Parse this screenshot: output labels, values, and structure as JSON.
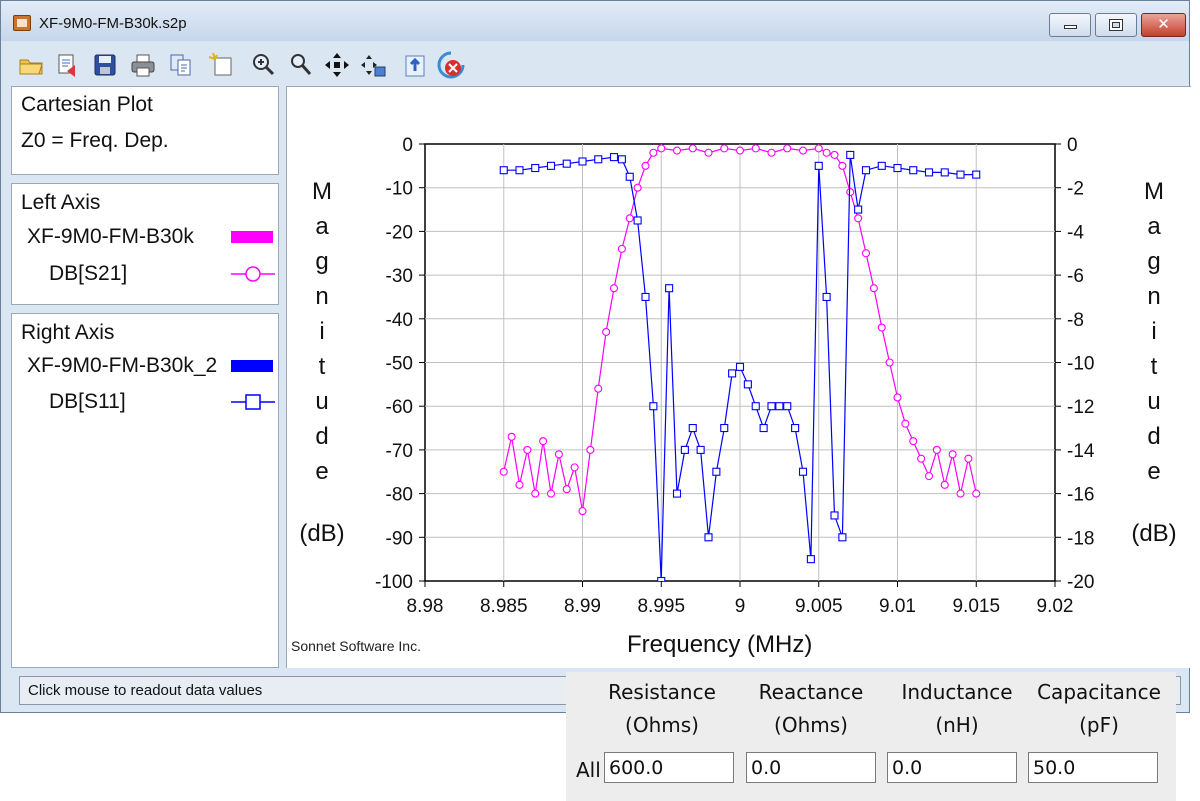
{
  "window": {
    "title": "XF-9M0-FM-B30k.s2p"
  },
  "toolbar": {
    "icons": [
      "open-folder-icon",
      "export-icon",
      "save-icon",
      "print-icon",
      "copy-icon",
      "new-plot-icon",
      "zoom-in-icon",
      "zoom-out-icon",
      "pan-icon",
      "measure-icon",
      "refresh-icon",
      "stop-icon"
    ]
  },
  "info_panel": {
    "title": "Cartesian Plot",
    "z0": "Z0 = Freq. Dep."
  },
  "left_axis_panel": {
    "heading": "Left Axis",
    "file": "XF-9M0-FM-B30k",
    "trace": "DB[S21]",
    "color": "#ff00ff"
  },
  "right_axis_panel": {
    "heading": "Right Axis",
    "file": "XF-9M0-FM-B30k_2",
    "trace": "DB[S11]",
    "color": "#0000ff"
  },
  "chart_data": {
    "type": "line",
    "xlabel": "Frequency (MHz)",
    "ylabel_left": "Magnitude",
    "ylabel_left_unit": "(dB)",
    "ylabel_right": "Magnitude",
    "ylabel_right_unit": "(dB)",
    "xlim": [
      8.98,
      9.02
    ],
    "ylim_left": [
      -100,
      0
    ],
    "ylim_right": [
      -20,
      0
    ],
    "x_ticks": [
      "8.98",
      "8.985",
      "8.99",
      "8.995",
      "9",
      "9.005",
      "9.01",
      "9.015",
      "9.02"
    ],
    "y_ticks_left": [
      "0",
      "-10",
      "-20",
      "-30",
      "-40",
      "-50",
      "-60",
      "-70",
      "-80",
      "-90",
      "-100"
    ],
    "y_ticks_right": [
      "0",
      "-2",
      "-4",
      "-6",
      "-8",
      "-10",
      "-12",
      "-14",
      "-16",
      "-18",
      "-20"
    ],
    "grid": true,
    "series": [
      {
        "name": "DB[S21]",
        "axis": "left",
        "color": "#ff00ff",
        "marker": "circle",
        "x": [
          8.985,
          8.9855,
          8.986,
          8.9865,
          8.987,
          8.9875,
          8.988,
          8.9885,
          8.989,
          8.9895,
          8.99,
          8.9905,
          8.991,
          8.9915,
          8.992,
          8.9925,
          8.993,
          8.9935,
          8.994,
          8.9945,
          8.995,
          8.996,
          8.997,
          8.998,
          8.999,
          9.0,
          9.001,
          9.002,
          9.003,
          9.004,
          9.005,
          9.0055,
          9.006,
          9.0065,
          9.007,
          9.0075,
          9.008,
          9.0085,
          9.009,
          9.0095,
          9.01,
          9.0105,
          9.011,
          9.0115,
          9.012,
          9.0125,
          9.013,
          9.0135,
          9.014,
          9.0145,
          9.015
        ],
        "y": [
          -75,
          -67,
          -78,
          -70,
          -80,
          -68,
          -80,
          -71,
          -79,
          -74,
          -84,
          -70,
          -56,
          -43,
          -33,
          -24,
          -17,
          -10,
          -5,
          -2,
          -1,
          -1.5,
          -1,
          -2,
          -1,
          -1.5,
          -1,
          -2,
          -1,
          -1.5,
          -1,
          -2,
          -2.5,
          -5,
          -11,
          -17,
          -25,
          -33,
          -42,
          -50,
          -58,
          -64,
          -68,
          -72,
          -76,
          -70,
          -78,
          -71,
          -80,
          -72,
          -80
        ]
      },
      {
        "name": "DB[S11]",
        "axis": "right",
        "color": "#0000ff",
        "marker": "square",
        "x": [
          8.985,
          8.986,
          8.987,
          8.988,
          8.989,
          8.99,
          8.991,
          8.992,
          8.9925,
          8.993,
          8.9935,
          8.994,
          8.9945,
          8.995,
          8.9955,
          8.996,
          8.9965,
          8.997,
          8.9975,
          8.998,
          8.9985,
          8.999,
          8.9995,
          9.0,
          9.0005,
          9.001,
          9.0015,
          9.002,
          9.0025,
          9.003,
          9.0035,
          9.004,
          9.0045,
          9.005,
          9.0055,
          9.006,
          9.0065,
          9.007,
          9.0075,
          9.008,
          9.009,
          9.01,
          9.011,
          9.012,
          9.013,
          9.014,
          9.015
        ],
        "y": [
          -1.2,
          -1.2,
          -1.1,
          -1.0,
          -0.9,
          -0.8,
          -0.7,
          -0.6,
          -0.7,
          -1.5,
          -3.5,
          -7,
          -12,
          -20,
          -6.6,
          -16,
          -14,
          -13,
          -14,
          -18,
          -15,
          -13,
          -10.5,
          -10.2,
          -11,
          -12,
          -13,
          -12,
          -12,
          -12,
          -13,
          -15,
          -19,
          -1,
          -7,
          -17,
          -18,
          -0.5,
          -3,
          -1.2,
          -1.0,
          -1.1,
          -1.2,
          -1.3,
          -1.3,
          -1.4,
          -1.4
        ]
      }
    ],
    "watermark": "Sonnet Software Inc."
  },
  "status": {
    "text": "Click mouse to readout data values"
  },
  "dialog": {
    "headers": [
      {
        "name": "Resistance",
        "unit": "(Ohms)"
      },
      {
        "name": "Reactance",
        "unit": "(Ohms)"
      },
      {
        "name": "Inductance",
        "unit": "(nH)"
      },
      {
        "name": "Capacitance",
        "unit": "(pF)"
      }
    ],
    "row_label": "All",
    "values": [
      "600.0",
      "0.0",
      "0.0",
      "50.0"
    ]
  }
}
